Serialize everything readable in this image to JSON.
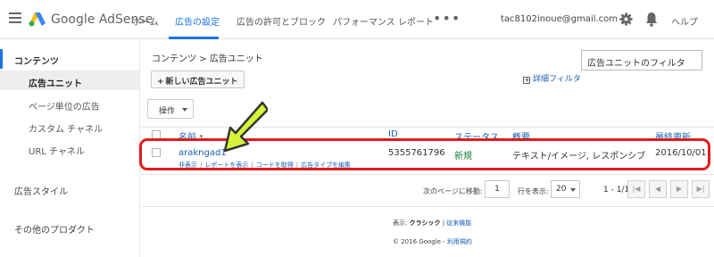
{
  "header": {
    "brand": "Google AdSense",
    "nav": [
      "ホーム",
      "広告の設定",
      "広告の許可とブロック",
      "パフォーマンス レポート"
    ],
    "more": "•••",
    "email": "tac8102inoue@gmail.com",
    "help": "ヘルプ"
  },
  "sidebar": {
    "items": [
      "コンテンツ",
      "広告ユニット",
      "ページ単位の広告",
      "カスタム チャネル",
      "URL チャネル",
      "広告スタイル",
      "その他のプロダクト"
    ]
  },
  "main": {
    "breadcrumb": "コンテンツ > 広告ユニット",
    "filter_placeholder": "広告ユニットのフィルタ",
    "new_button": "新しい広告ユニット",
    "new_plus": "+",
    "advanced_filter": "詳細フィルタ",
    "advanced_plus": "+",
    "action_button": "操作",
    "table": {
      "headers": [
        "名前",
        "ID",
        "ステータス",
        "概要",
        "最終更新"
      ],
      "sort_arrow": "↑",
      "row": {
        "name": "arakngad1",
        "id": "5355761796",
        "status": "新規",
        "summary": "テキスト/イメージ, レスポンシブ",
        "updated": "2016/10/01",
        "links": [
          "非表示",
          "レポートを表示",
          "コードを取得",
          "広告タイプを編集"
        ],
        "separator": "|"
      }
    },
    "pagination": {
      "goto_label": "次のページに移動:",
      "page": "1",
      "rows_label": "行を表示:",
      "rows": "20",
      "range": "1 - 1/1",
      "buttons": [
        "|◀",
        "◀",
        "▶",
        "▶|"
      ]
    },
    "footer": {
      "display_label": "表示:",
      "classic": "クラシック",
      "separator": "|",
      "old_classic": "従来機能",
      "copyright": "© 2016 Google -",
      "terms": "利用規約"
    }
  },
  "colors": {
    "accent": "#1a73e8",
    "link": "#1a5fb4",
    "status_new": "#188038",
    "highlight": "#e21b1b",
    "arrow_fill": "#d9f23a"
  }
}
